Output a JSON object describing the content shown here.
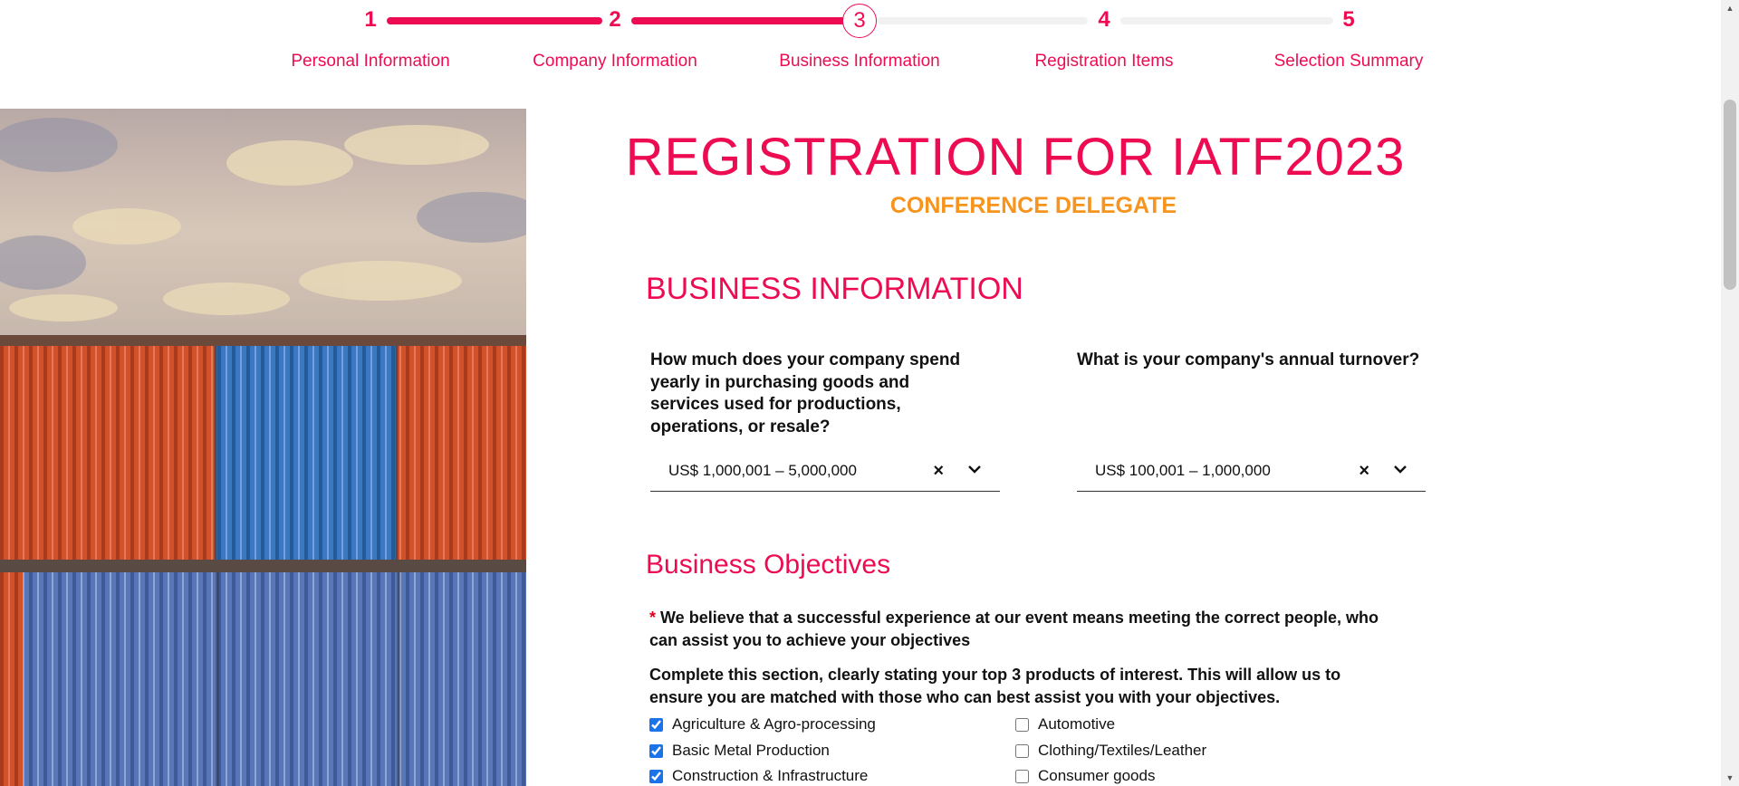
{
  "stepper": {
    "steps": [
      {
        "number": "1",
        "label": "Personal Information"
      },
      {
        "number": "2",
        "label": "Company Information"
      },
      {
        "number": "3",
        "label": "Business Information"
      },
      {
        "number": "4",
        "label": "Registration Items"
      },
      {
        "number": "5",
        "label": "Selection Summary"
      }
    ],
    "current_step": 3,
    "accent_color": "#ed0c52"
  },
  "page": {
    "title": "REGISTRATION FOR IATF2023",
    "subtitle": "CONFERENCE DELEGATE",
    "subtitle_color": "#f7941d"
  },
  "business_info": {
    "heading": "BUSINESS INFORMATION",
    "spend_question": "How much does your company spend yearly in purchasing goods and services used for productions, operations, or resale?",
    "spend_value": "US$ 1,000,001 – 5,000,000",
    "turnover_question": "What is your company's annual turnover?",
    "turnover_value": "US$ 100,001 – 1,000,000",
    "clear_icon": "×"
  },
  "objectives": {
    "heading": "Business Objectives",
    "required_mark": "*",
    "intro": " We believe that a successful experience at our event means meeting the correct people, who can assist you to achieve your objectives",
    "instruction": "Complete this section, clearly stating your top 3 products of interest. This will allow us to ensure you are matched with those who can best assist you with your objectives.",
    "options": [
      {
        "label": "Agriculture & Agro-processing",
        "checked": true
      },
      {
        "label": "Automotive",
        "checked": false
      },
      {
        "label": "Basic Metal Production",
        "checked": true
      },
      {
        "label": "Clothing/Textiles/Leather",
        "checked": false
      },
      {
        "label": "Construction & Infrastructure",
        "checked": true
      },
      {
        "label": "Consumer goods",
        "checked": false
      }
    ]
  }
}
